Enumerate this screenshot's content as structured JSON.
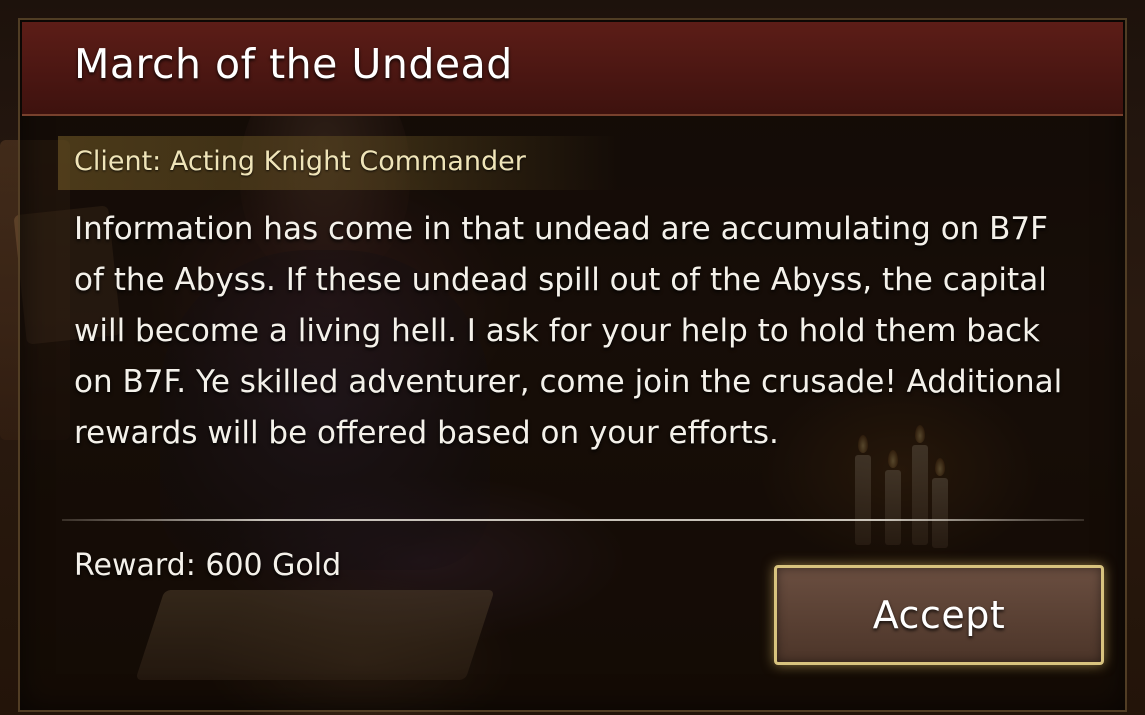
{
  "quest": {
    "title": "March of the Undead",
    "client": "Client: Acting Knight Commander",
    "description": "Information has come in that undead are accumulating on B7F of the Abyss. If these undead spill out of the Abyss, the capital will become a living hell. I ask for your help to hold them back on B7F. Ye skilled adventurer, come join the crusade! Additional rewards will be offered based on your efforts.",
    "reward": "Reward: 600 Gold",
    "accept_label": "Accept"
  },
  "colors": {
    "title_bar": "#4a1612",
    "client_text": "#efe4b8",
    "button_border": "#d8c37e",
    "button_fill": "#5a4034"
  }
}
